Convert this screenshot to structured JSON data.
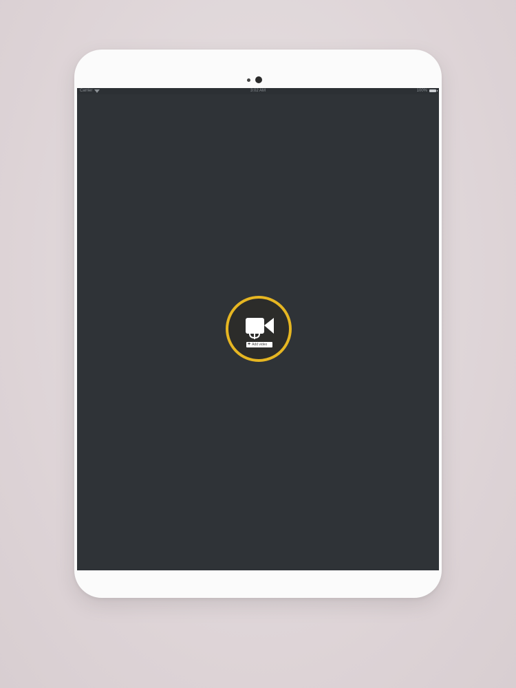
{
  "status_bar": {
    "carrier": "Carrier",
    "time": "3:02 AM",
    "battery": "100%"
  },
  "record_button": {
    "badge_label": "Add video"
  },
  "colors": {
    "accent": "#e6b622",
    "screen": "#2f3337",
    "bezel": "#fbfbfb",
    "background": "#e2dadc"
  },
  "icons": {
    "record_icon": "video-camera-icon",
    "network_icon": "wifi-icon",
    "power_icon": "battery-icon"
  }
}
